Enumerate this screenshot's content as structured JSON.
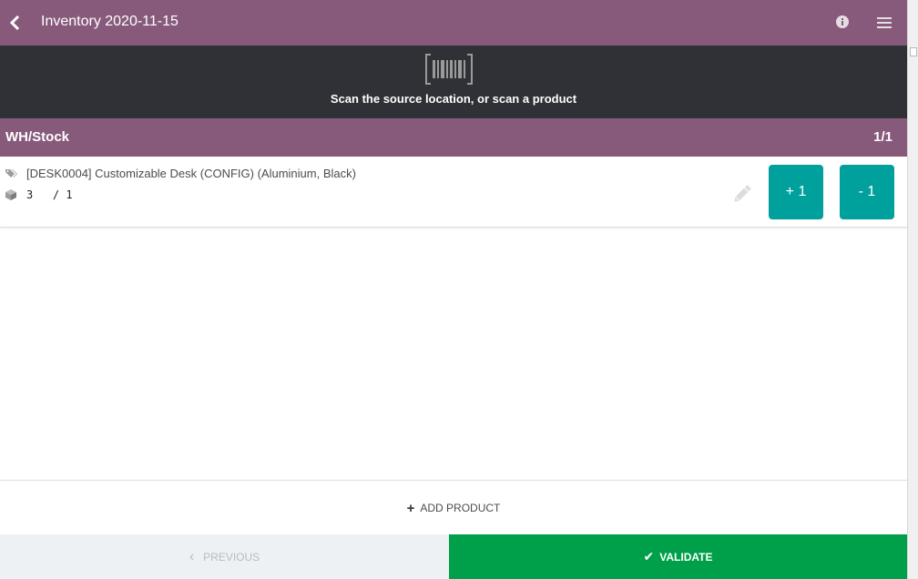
{
  "header": {
    "title": "Inventory 2020-11-15",
    "back_icon": "chevron-left-icon",
    "info_icon": "info-icon",
    "menu_icon": "hamburger-menu-icon"
  },
  "scan": {
    "icon": "barcode-icon",
    "message": "Scan the source location, or scan a product"
  },
  "location": {
    "name": "WH/Stock",
    "counter": "1/1"
  },
  "lines": [
    {
      "product": "[DESK0004] Customizable Desk (CONFIG) (Aluminium, Black)",
      "quantity": "3   / 1",
      "plus_label": "+ 1",
      "minus_label": "- 1"
    }
  ],
  "footer": {
    "add_product_label": "ADD PRODUCT",
    "previous_label": "PREVIOUS",
    "validate_label": "VALIDATE"
  },
  "colors": {
    "header": "#875a7b",
    "scanbar": "#2f3136",
    "accent": "#00a09d",
    "validate": "#00a04a"
  }
}
